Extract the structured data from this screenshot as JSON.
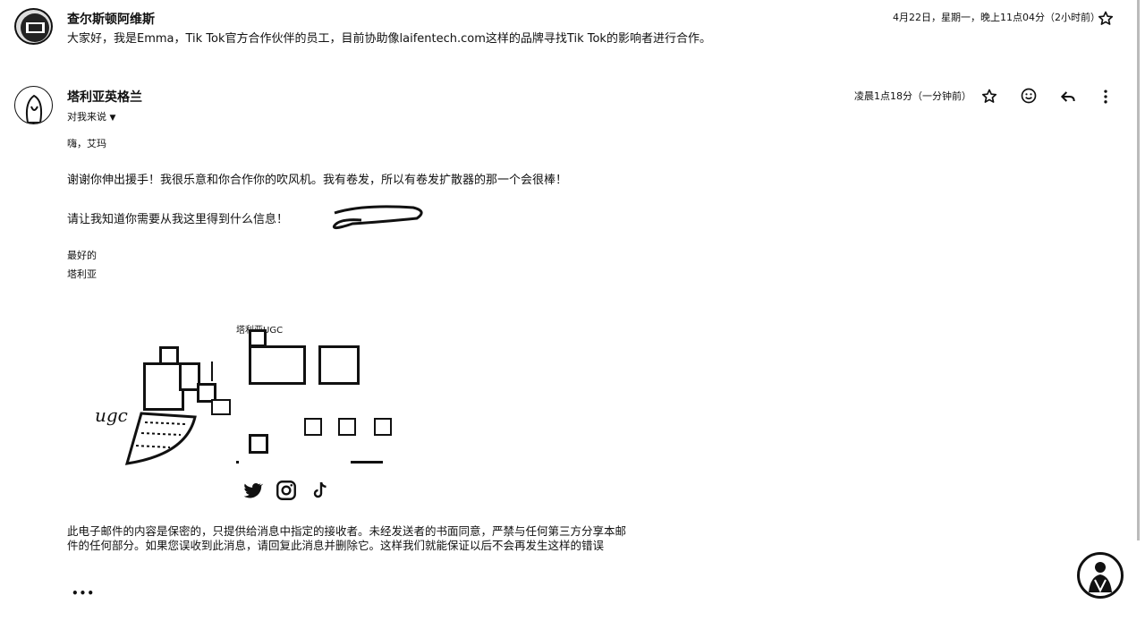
{
  "message1": {
    "sender": "查尔斯顿阿维斯",
    "date": "4月22日，星期一，晚上11点04分（2小时前）",
    "body": "大家好，我是Emma，Tik Tok官方合作伙伴的员工，目前协助像laifentech.com这样的品牌寻找Tik Tok的影响者进行合作。",
    "star_icon": "star-outline-icon"
  },
  "message2": {
    "sender": "塔利亚英格兰",
    "to_me": "对我来说",
    "date": "凌晨1点18分（一分钟前）",
    "greeting": "嗨，艾玛",
    "para1": "谢谢你伸出援手！我很乐意和你合作你的吹风机。我有卷发，所以有卷发扩散器的那一个会很棒！",
    "para2": "请让我知道你需要从我这里得到什么信息！",
    "closing": "最好的",
    "signature": "塔利亚",
    "brand_title": "塔利亚UGC",
    "brand_logo_text": "ugc",
    "disclaimer_line1": "此电子邮件的内容是保密的，只提供给消息中指定的接收者。未经发送者的书面同意，严禁与任何第三方分享本邮",
    "disclaimer_line2": "件的任何部分。如果您误收到此消息，请回复此消息并删除它。这样我们就能保证以后不会再发生这样的错误",
    "more": "•••"
  },
  "icons": [
    "star-icon",
    "emoji-icon",
    "reply-icon",
    "more-vert-icon",
    "twitter-icon",
    "instagram-icon",
    "tiktok-icon"
  ]
}
